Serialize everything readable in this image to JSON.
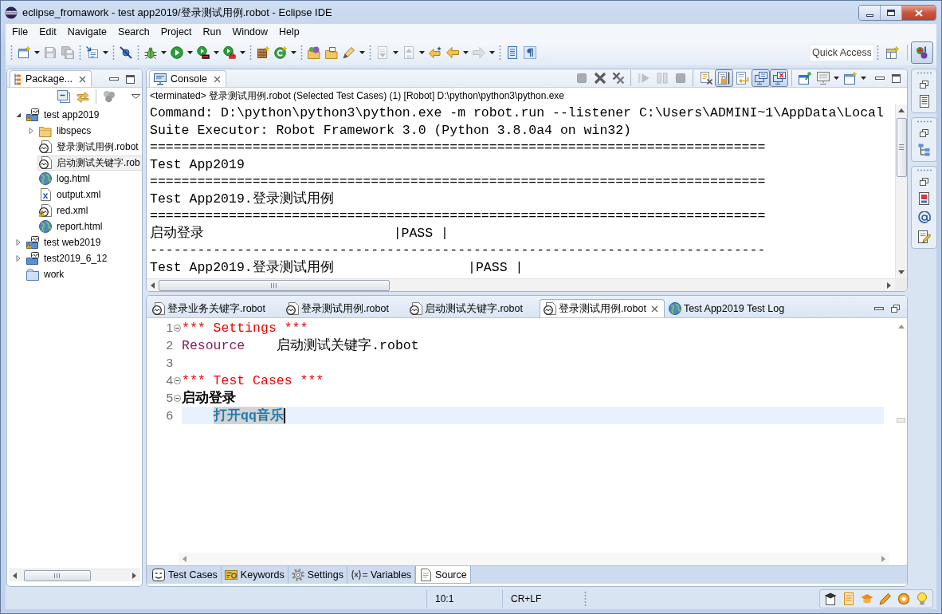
{
  "window": {
    "title": "eclipse_fromawork - test app2019/登录测试用例.robot - Eclipse IDE"
  },
  "menu": [
    "File",
    "Edit",
    "Navigate",
    "Search",
    "Project",
    "Run",
    "Window",
    "Help"
  ],
  "toolbar": {
    "groups": [
      [
        {
          "kind": "new",
          "disabled": false,
          "dropdown": true
        },
        {
          "kind": "save",
          "disabled": true
        },
        {
          "kind": "save_all",
          "disabled": true
        }
      ],
      [
        {
          "kind": "wizard",
          "disabled": false,
          "dropdown": true
        }
      ],
      [
        {
          "kind": "skip_breakpoints",
          "disabled": false
        }
      ],
      [
        {
          "kind": "debug",
          "disabled": false,
          "dropdown": true
        },
        {
          "kind": "run",
          "disabled": false,
          "dropdown": true
        },
        {
          "kind": "coverage",
          "disabled": false,
          "dropdown": true
        },
        {
          "kind": "external",
          "disabled": false,
          "dropdown": true
        }
      ],
      [
        {
          "kind": "new_package",
          "disabled": false
        },
        {
          "kind": "new_class",
          "disabled": false,
          "dropdown": true
        }
      ],
      [
        {
          "kind": "open_type",
          "disabled": false
        },
        {
          "kind": "open_task",
          "disabled": false
        },
        {
          "kind": "pen",
          "disabled": false,
          "dropdown": true
        }
      ],
      [
        {
          "kind": "next_annotation",
          "disabled": true,
          "dropdown": true
        },
        {
          "kind": "prev_annotation",
          "disabled": true,
          "dropdown": true
        },
        {
          "kind": "last_edit",
          "disabled": false
        },
        {
          "kind": "back",
          "disabled": false,
          "dropdown": true
        },
        {
          "kind": "forward",
          "disabled": true,
          "dropdown": true
        }
      ],
      [
        {
          "kind": "block",
          "disabled": false
        },
        {
          "kind": "pilcrow",
          "disabled": false
        }
      ]
    ],
    "quick_access": {
      "placeholder": "Quick Access"
    },
    "perspectives": [
      {
        "kind": "open_perspective",
        "selected": false
      },
      {
        "kind": "robot",
        "selected": true
      }
    ]
  },
  "package_explorer": {
    "tab": {
      "label": "Package...",
      "selected": true
    },
    "tree": [
      {
        "label": "test app2019",
        "kind": "project",
        "warning": true,
        "expanded": true,
        "selected": false,
        "children": [
          {
            "label": "libspecs",
            "kind": "folder",
            "warning": false,
            "expanded": false,
            "selected": false
          },
          {
            "label": "登录测试用例.robot",
            "kind": "robot",
            "warning": false,
            "selected": false
          },
          {
            "label": "启动测试关键字.rob",
            "kind": "robot",
            "warning": false,
            "selected": true
          },
          {
            "label": "log.html",
            "kind": "html",
            "warning": false,
            "selected": false
          },
          {
            "label": "output.xml",
            "kind": "xml",
            "warning": false,
            "selected": false
          },
          {
            "label": "red.xml",
            "kind": "robot",
            "warning": true,
            "selected": false
          },
          {
            "label": "report.html",
            "kind": "html",
            "warning": false,
            "selected": false
          }
        ]
      },
      {
        "label": "test web2019",
        "kind": "project",
        "warning": true,
        "expanded": false,
        "selected": false
      },
      {
        "label": "test2019_6_12",
        "kind": "project",
        "warning": false,
        "expanded": false,
        "selected": false
      },
      {
        "label": "work",
        "kind": "closed_project",
        "warning": false,
        "selected": false
      }
    ]
  },
  "console": {
    "tab": {
      "label": "Console",
      "selected": true
    },
    "toolbar": [
      [
        {
          "kind": "terminate",
          "disabled": true
        },
        {
          "kind": "remove",
          "disabled": false
        },
        {
          "kind": "remove_all",
          "disabled": false
        }
      ],
      [
        {
          "kind": "step",
          "disabled": true
        },
        {
          "kind": "suspend",
          "disabled": true
        },
        {
          "kind": "stop",
          "disabled": true
        }
      ],
      [
        {
          "kind": "clear",
          "disabled": false
        },
        {
          "kind": "scroll_lock",
          "disabled": false,
          "pressed": true
        },
        {
          "kind": "word_wrap",
          "disabled": false,
          "pressed": false
        },
        {
          "kind": "show_stdout",
          "disabled": false,
          "pressed": true
        },
        {
          "kind": "show_stderr",
          "disabled": false,
          "pressed": true
        }
      ],
      [
        {
          "kind": "pin",
          "disabled": false
        },
        {
          "kind": "display_console",
          "disabled": false,
          "dropdown": true
        },
        {
          "kind": "open_console",
          "disabled": false,
          "dropdown": true
        }
      ]
    ],
    "status": "<terminated> 登录测试用例.robot (Selected Test Cases) (1) [Robot] D:\\python\\python3\\python.exe",
    "lines": [
      "Command: D:\\python\\python3\\python.exe -m robot.run --listener C:\\Users\\ADMINI~1\\AppData\\Local",
      "Suite Executor: Robot Framework 3.0 (Python 3.8.0a4 on win32)",
      "==============================================================================",
      "Test App2019",
      "==============================================================================",
      "Test App2019.登录测试用例",
      "==============================================================================",
      "启动登录                        |PASS |",
      "------------------------------------------------------------------------------",
      "Test App2019.登录测试用例                 |PASS |"
    ]
  },
  "editor": {
    "tabs": [
      {
        "label": "登录业务关键字.robot",
        "kind": "robot",
        "selected": false
      },
      {
        "label": "登录测试用例.robot",
        "kind": "robot",
        "selected": false
      },
      {
        "label": "启动测试关键字.robot",
        "kind": "robot",
        "selected": false
      },
      {
        "label": "登录测试用例.robot",
        "kind": "robot",
        "selected": true
      },
      {
        "label": "Test App2019 Test Log",
        "kind": "log",
        "selected": false
      }
    ],
    "lines": [
      {
        "number": "1",
        "expanded": true,
        "current": false,
        "segments": [
          {
            "text": "*** Settings ***",
            "kind": "section",
            "highlighted": false
          }
        ]
      },
      {
        "number": "2",
        "current": false,
        "segments": [
          {
            "text": "Resource",
            "kind": "setting",
            "highlighted": false
          },
          {
            "text": "启动测试关键字.robot",
            "kind": "value",
            "highlighted": false
          }
        ]
      },
      {
        "number": "3",
        "current": false
      },
      {
        "number": "4",
        "expanded": true,
        "current": false,
        "segments": [
          {
            "text": "*** Test Cases ***",
            "kind": "section",
            "highlighted": false
          }
        ]
      },
      {
        "number": "5",
        "expanded": true,
        "current": false,
        "segments": [
          {
            "text": "启动登录",
            "kind": "test_name",
            "highlighted": false
          }
        ]
      },
      {
        "number": "6",
        "current": true,
        "segments": [
          {
            "text": "打开qq音乐",
            "kind": "keyword",
            "highlighted": true
          }
        ]
      }
    ],
    "page_tabs": [
      {
        "label": "Test Cases",
        "kind": "test_cases",
        "selected": false
      },
      {
        "label": "Keywords",
        "kind": "keywords",
        "selected": false
      },
      {
        "label": "Settings",
        "kind": "settings",
        "selected": false
      },
      {
        "label": "Variables",
        "kind": "variables",
        "selected": false
      },
      {
        "label": "Source",
        "kind": "source",
        "selected": true
      }
    ]
  },
  "status_bar": {
    "position": "10:1",
    "line_ending": "CR+LF"
  }
}
